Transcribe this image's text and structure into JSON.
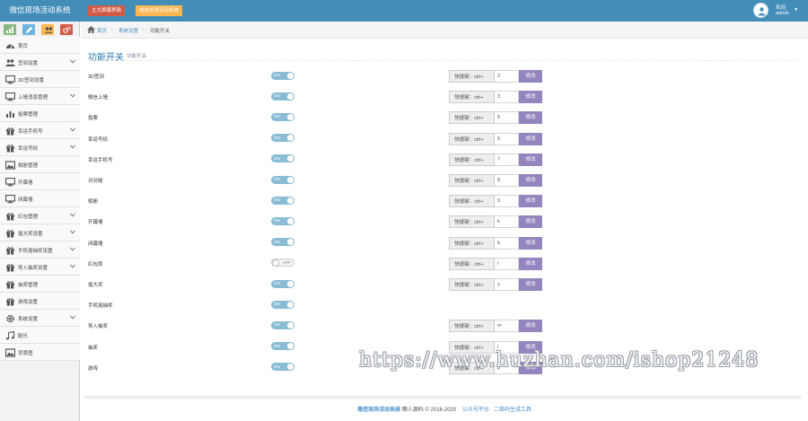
{
  "header": {
    "brand": "微信现场活动系统",
    "btn_main_screen": "主大屏幕界面",
    "btn_admin": "微信现场活动系统",
    "user_greeting": "欢迎,",
    "user_name": "admin"
  },
  "sidebar": {
    "shortcuts": [
      {
        "icon": "signal-icon",
        "color": "#87b87f"
      },
      {
        "icon": "pencil-icon",
        "color": "#6fb3e0"
      },
      {
        "icon": "users-icon",
        "color": "#ffb752"
      },
      {
        "icon": "cogs-icon",
        "color": "#d15b47"
      }
    ],
    "items": [
      {
        "label": "首页",
        "icon": "dashboard-icon",
        "has_submenu": false
      },
      {
        "label": "签到设置",
        "icon": "users-icon",
        "has_submenu": true
      },
      {
        "label": "3D签到设置",
        "icon": "desktop-icon",
        "has_submenu": false
      },
      {
        "label": "上墙消息管理",
        "icon": "desktop-icon",
        "has_submenu": true
      },
      {
        "label": "投票管理",
        "icon": "bar-chart-icon",
        "has_submenu": false
      },
      {
        "label": "幸运手机号",
        "icon": "gift-icon",
        "has_submenu": true
      },
      {
        "label": "幸运号码",
        "icon": "gift-icon",
        "has_submenu": true
      },
      {
        "label": "相册管理",
        "icon": "picture-icon",
        "has_submenu": false
      },
      {
        "label": "开幕墙",
        "icon": "desktop-icon",
        "has_submenu": false
      },
      {
        "label": "闭幕墙",
        "icon": "desktop-icon",
        "has_submenu": false
      },
      {
        "label": "红包管理",
        "icon": "gift-icon",
        "has_submenu": true
      },
      {
        "label": "摇大奖设置",
        "icon": "gift-icon",
        "has_submenu": true
      },
      {
        "label": "手机摇抽奖设置",
        "icon": "gift-icon",
        "has_submenu": true
      },
      {
        "label": "导入抽奖设置",
        "icon": "gift-icon",
        "has_submenu": true
      },
      {
        "label": "抽奖管理",
        "icon": "gift-icon",
        "has_submenu": false
      },
      {
        "label": "游戏设置",
        "icon": "gift-icon",
        "has_submenu": false
      },
      {
        "label": "系统设置",
        "icon": "cog-icon",
        "has_submenu": true
      },
      {
        "label": "配乐",
        "icon": "music-icon",
        "has_submenu": false
      },
      {
        "label": "背景图",
        "icon": "picture-icon",
        "has_submenu": false
      }
    ]
  },
  "breadcrumb": {
    "home": "首页",
    "settings": "系统设置",
    "current": "功能开关"
  },
  "page": {
    "title": "功能开关",
    "subtitle": "功能开关"
  },
  "switch_texts": {
    "on": "ON",
    "off": "OFF"
  },
  "shortcut_label": "快捷键：ctrl+",
  "modify_label": "修改",
  "features": [
    {
      "label": "3D签到",
      "enabled": true,
      "shortcut": "2"
    },
    {
      "label": "微信上墙",
      "enabled": true,
      "shortcut": "3"
    },
    {
      "label": "投票",
      "enabled": true,
      "shortcut": "5"
    },
    {
      "label": "幸运号码",
      "enabled": true,
      "shortcut": "6"
    },
    {
      "label": "幸运手机号",
      "enabled": true,
      "shortcut": "7"
    },
    {
      "label": "对对碰",
      "enabled": true,
      "shortcut": "8"
    },
    {
      "label": "相册",
      "enabled": true,
      "shortcut": "9"
    },
    {
      "label": "开幕墙",
      "enabled": true,
      "shortcut": "k"
    },
    {
      "label": "闭幕墙",
      "enabled": true,
      "shortcut": "b"
    },
    {
      "label": "红包雨",
      "enabled": false,
      "shortcut": "r"
    },
    {
      "label": "摇大奖",
      "enabled": true,
      "shortcut": "y"
    },
    {
      "label": "手机摇抽奖",
      "enabled": true,
      "shortcut": null
    },
    {
      "label": "导入抽奖",
      "enabled": true,
      "shortcut": "m"
    },
    {
      "label": "抽奖",
      "enabled": true,
      "shortcut": "l"
    },
    {
      "label": "游戏",
      "enabled": true,
      "shortcut": "p"
    }
  ],
  "footer": {
    "brand": "微信现场活动系统",
    "author": "懒人源码",
    "copyright": "© 2016-2020",
    "link_platform": "公众号平台",
    "link_qr": "二维码生成工具"
  },
  "watermark": "https://www.huzhan.com/ishop21248"
}
